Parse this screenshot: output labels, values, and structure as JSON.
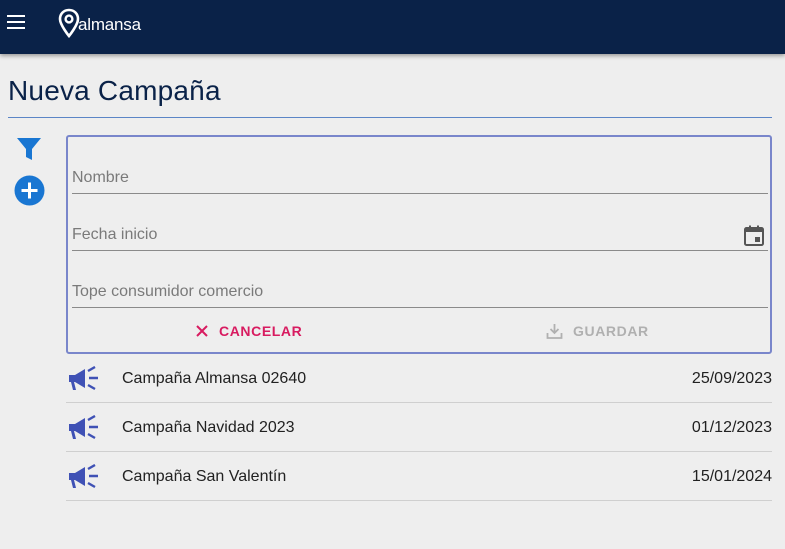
{
  "header": {
    "logo_text": "almansa",
    "colors": {
      "bar": "#0a2248",
      "accent": "#1976d2"
    }
  },
  "page": {
    "title": "Nueva Campaña"
  },
  "sidebar_actions": {
    "filter_icon": "filter-icon",
    "add_icon": "add-circle-icon"
  },
  "form": {
    "fields": [
      {
        "label": "Nombre",
        "value": ""
      },
      {
        "label": "Fecha inicio",
        "value": "",
        "icon": "calendar-icon"
      },
      {
        "label": "Tope consumidor comercio",
        "value": ""
      }
    ],
    "cancel_label": "CANCELAR",
    "save_label": "GUARDAR",
    "colors": {
      "border": "#7986cb",
      "cancel": "#d81b60",
      "disabled": "#b0b0b0"
    }
  },
  "campaigns": [
    {
      "name": "Campaña Almansa 02640",
      "date": "25/09/2023",
      "icon": "megaphone-icon"
    },
    {
      "name": "Campaña Navidad 2023",
      "date": "01/12/2023",
      "icon": "megaphone-icon"
    },
    {
      "name": "Campaña San Valentín",
      "date": "15/01/2024",
      "icon": "megaphone-icon"
    }
  ]
}
